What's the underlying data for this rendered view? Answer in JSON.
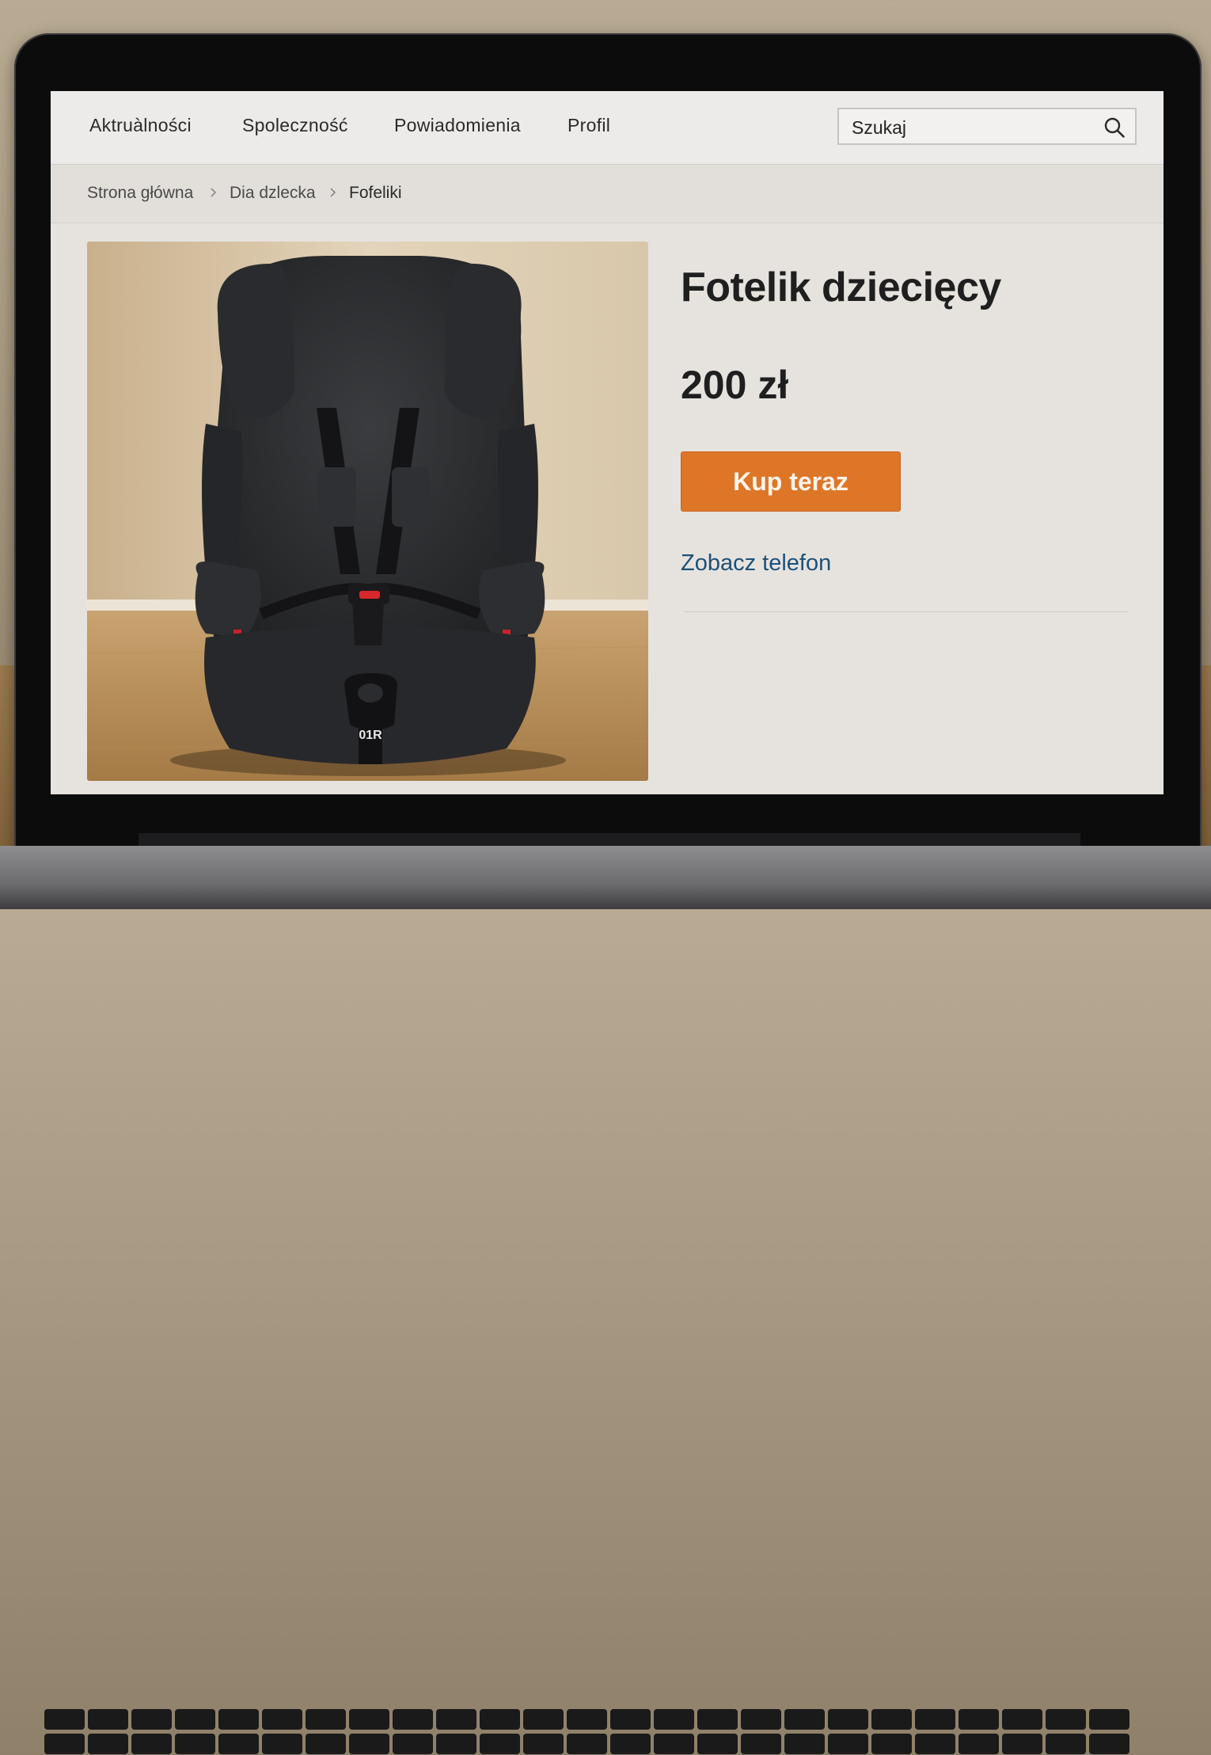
{
  "nav": {
    "items": [
      {
        "label": "Aktruàlności"
      },
      {
        "label": "Spoleczność"
      },
      {
        "label": "Powiadomienia"
      },
      {
        "label": "Profil"
      }
    ],
    "search": {
      "placeholder": "Szukaj",
      "icon": "search-icon"
    }
  },
  "breadcrumb": {
    "items": [
      {
        "label": "Strona główna"
      },
      {
        "label": "Dia dzlecka"
      },
      {
        "label": "Fofeliki"
      }
    ],
    "separator_icon": "chevron-right-icon"
  },
  "product": {
    "image_alt": "Fotelik dziecięcy",
    "title": "Fotelik dziecięcy",
    "price": "200 zł",
    "buy_label": "Kup teraz",
    "phone_link": "Zobacz telefon",
    "buckle_text": "01R"
  },
  "colors": {
    "accent": "#de7628",
    "link": "#1d5077",
    "screen_bg": "#e6e3df"
  }
}
